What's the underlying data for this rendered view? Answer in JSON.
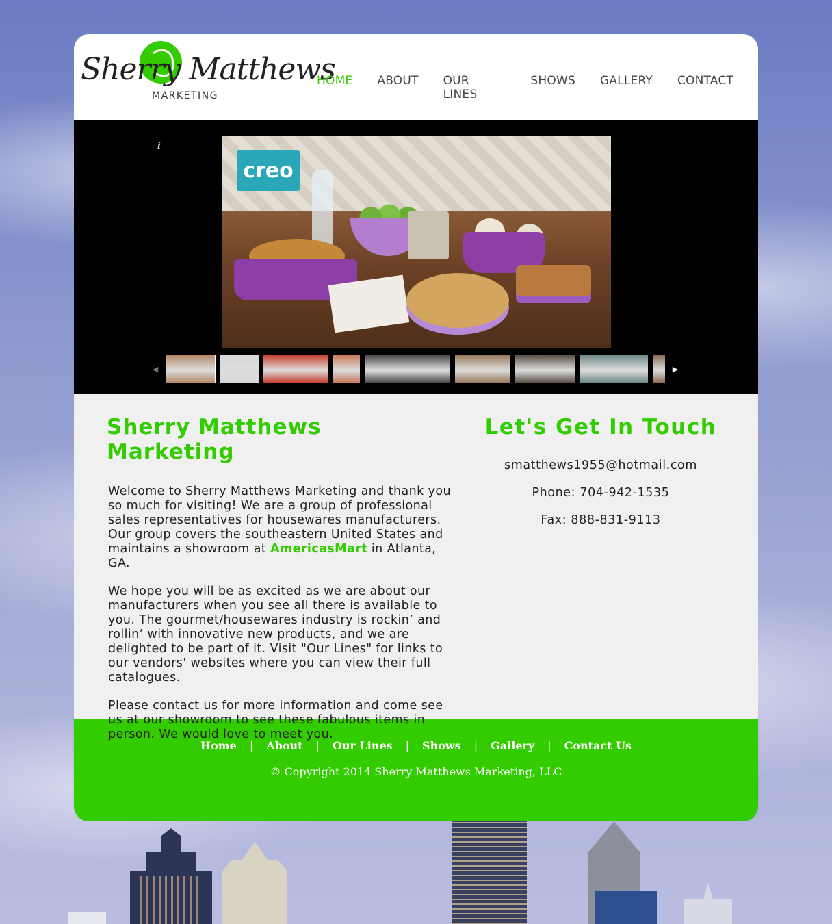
{
  "logo": {
    "script_text": "Sherry Matthews",
    "subtitle": "MARKETING"
  },
  "nav": {
    "items": [
      {
        "label": "HOME",
        "active": true
      },
      {
        "label": "ABOUT",
        "active": false
      },
      {
        "label": "OUR LINES",
        "active": false
      },
      {
        "label": "SHOWS",
        "active": false
      },
      {
        "label": "GALLERY",
        "active": false
      },
      {
        "label": "CONTACT",
        "active": false
      }
    ]
  },
  "slider": {
    "info_icon": "i",
    "main_photo_brand": "creo",
    "prev_arrow": "◀",
    "next_arrow": "▶",
    "thumbnails": [
      {
        "width": 72,
        "color": "#b58a6a"
      },
      {
        "width": 57,
        "color": "#d8d8d8"
      },
      {
        "width": 94,
        "color": "#c84030"
      },
      {
        "width": 40,
        "color": "#c77a5c"
      },
      {
        "width": 125,
        "color": "#4a4a4a"
      },
      {
        "width": 81,
        "color": "#9a7a5c"
      },
      {
        "width": 87,
        "color": "#5b5146"
      },
      {
        "width": 100,
        "color": "#6f8a88"
      },
      {
        "width": 30,
        "color": "#8a6d52"
      }
    ]
  },
  "main": {
    "title": "Sherry Matthews Marketing",
    "p1_before": "Welcome to Sherry Matthews Marketing and thank you so much for visiting! We are a group of professional sales representatives for housewares manufacturers. Our group covers the southeastern United States and maintains a showroom at ",
    "p1_link": "AmericasMart",
    "p1_after": " in Atlanta, GA.",
    "p2": "We hope you will be as excited as we are about our manufacturers when you see all there is available to you. The gourmet/housewares industry is rockin’ and rollin’ with innovative new products, and we are delighted to be part of it. Visit \"Our Lines\" for links to our vendors' websites where you can view their full catalogues.",
    "p3": "Please contact us for more information and come see us at our showroom to see these fabulous items in person. We would love to meet you."
  },
  "contact": {
    "title": "Let's Get In Touch",
    "email": "smatthews1955@hotmail.com",
    "phone": "Phone: 704-942-1535",
    "fax": "Fax: 888-831-9113"
  },
  "footer": {
    "links": [
      "Home",
      "About",
      "Our Lines",
      "Shows",
      "Gallery",
      "Contact Us"
    ],
    "separator": "|",
    "copyright": "© Copyright 2014 Sherry Matthews Marketing, LLC"
  },
  "colors": {
    "accent": "#33cc00",
    "nav_text": "#444444",
    "content_bg": "#f0f0f0"
  }
}
